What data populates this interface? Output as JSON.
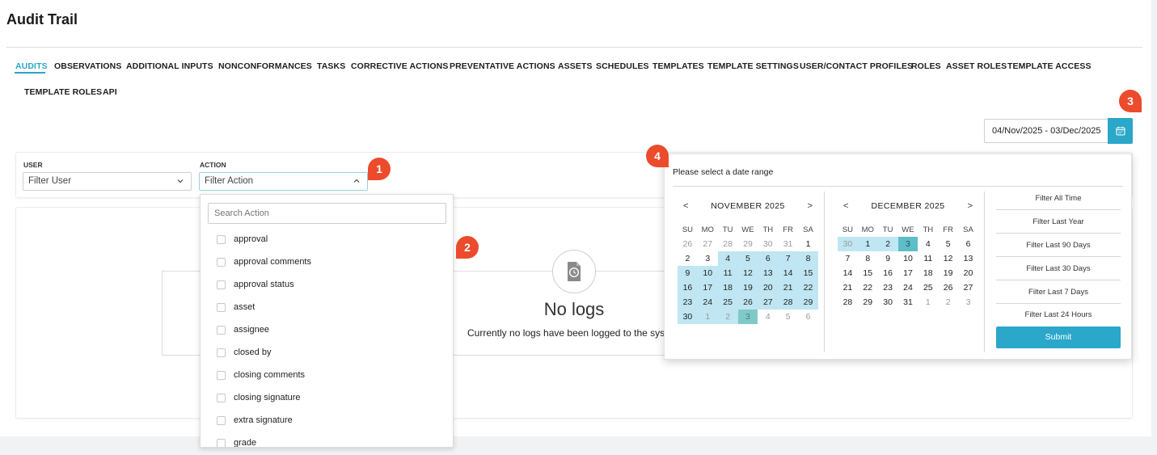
{
  "page": {
    "title": "Audit Trail"
  },
  "tabs": [
    {
      "label": "AUDITS",
      "active": true
    },
    {
      "label": "OBSERVATIONS"
    },
    {
      "label": "ADDITIONAL INPUTS"
    },
    {
      "label": "NONCONFORMANCES"
    },
    {
      "label": "TASKS"
    },
    {
      "label": "CORRECTIVE ACTIONS"
    },
    {
      "label": "PREVENTATIVE ACTIONS"
    },
    {
      "label": "ASSETS"
    },
    {
      "label": "SCHEDULES"
    },
    {
      "label": "TEMPLATES"
    },
    {
      "label": "TEMPLATE SETTINGS"
    },
    {
      "label": "USER/CONTACT PROFILES"
    },
    {
      "label": "ROLES"
    },
    {
      "label": "ASSET ROLES"
    },
    {
      "label": "TEMPLATE ACCESS"
    },
    {
      "label": "TEMPLATE ROLES"
    },
    {
      "label": "API"
    }
  ],
  "filters": {
    "user": {
      "label": "USER",
      "value": "Filter User"
    },
    "action": {
      "label": "ACTION",
      "value": "Filter Action"
    }
  },
  "action_dropdown": {
    "search_placeholder": "Search Action",
    "options": [
      "approval",
      "approval comments",
      "approval status",
      "asset",
      "assignee",
      "closed by",
      "closing comments",
      "closing signature",
      "extra signature",
      "grade"
    ]
  },
  "empty_state": {
    "title": "No logs",
    "message": "Currently no logs have been logged to the syst"
  },
  "date_range": {
    "value": "04/Nov/2025 - 03/Dec/2025",
    "caption": "Please select a date range",
    "prev": "<",
    "next": ">",
    "weekdays": [
      "SU",
      "MO",
      "TU",
      "WE",
      "TH",
      "FR",
      "SA"
    ],
    "months": [
      {
        "title": "NOVEMBER 2025",
        "rows": [
          [
            "26",
            "27",
            "28",
            "29",
            "30",
            "31",
            "1"
          ],
          [
            "2",
            "3",
            "4",
            "5",
            "6",
            "7",
            "8"
          ],
          [
            "9",
            "10",
            "11",
            "12",
            "13",
            "14",
            "15"
          ],
          [
            "16",
            "17",
            "18",
            "19",
            "20",
            "21",
            "22"
          ],
          [
            "23",
            "24",
            "25",
            "26",
            "27",
            "28",
            "29"
          ],
          [
            "30",
            "1",
            "2",
            "3",
            "4",
            "5",
            "6"
          ]
        ]
      },
      {
        "title": "DECEMBER 2025",
        "rows": [
          [
            "30",
            "1",
            "2",
            "3",
            "4",
            "5",
            "6"
          ],
          [
            "7",
            "8",
            "9",
            "10",
            "11",
            "12",
            "13"
          ],
          [
            "14",
            "15",
            "16",
            "17",
            "18",
            "19",
            "20"
          ],
          [
            "21",
            "22",
            "23",
            "24",
            "25",
            "26",
            "27"
          ],
          [
            "28",
            "29",
            "30",
            "31",
            "1",
            "2",
            "3"
          ]
        ]
      }
    ],
    "presets": [
      "Filter All Time",
      "Filter Last Year",
      "Filter Last 90 Days",
      "Filter Last 30 Days",
      "Filter Last 7 Days",
      "Filter Last 24 Hours"
    ],
    "submit_label": "Submit"
  },
  "annotations": [
    "1",
    "2",
    "3",
    "4"
  ],
  "colors": {
    "accent": "#2aa7c9",
    "range": "#bfe6f2",
    "range_edge": "#5dbdc8",
    "badge": "#ec4b2c"
  },
  "icons": {
    "date_button": "calendar-icon",
    "empty_state": "clock-document-icon"
  }
}
